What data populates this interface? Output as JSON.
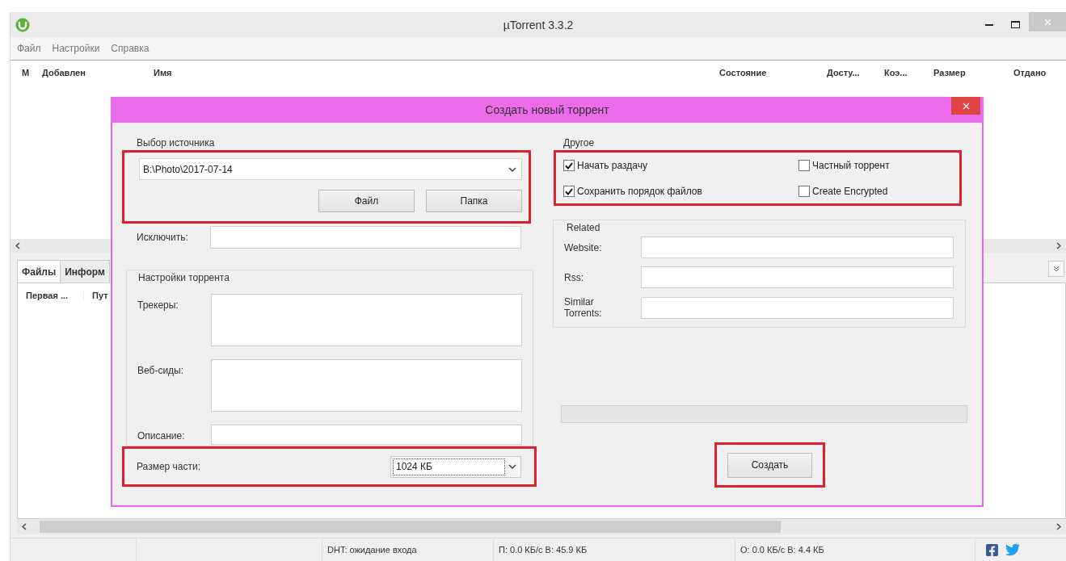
{
  "window": {
    "title": "µTorrent 3.3.2"
  },
  "menu": [
    "Файл",
    "Настройки",
    "Справка"
  ],
  "torrent_list": {
    "columns": [
      "М",
      "Добавлен",
      "Имя",
      "Состояние",
      "Досту...",
      "Коэ...",
      "Размер",
      "Отдано"
    ]
  },
  "tabs": [
    {
      "label": "Файлы",
      "selected": true
    },
    {
      "label": "Информ",
      "selected": false
    }
  ],
  "files_list": {
    "columns": [
      "Первая ...",
      "Пут"
    ]
  },
  "status_bar": [
    "DHT: ожидание входа",
    "П: 0.0 КБ/с В: 45.9 КБ",
    "О: 0.0 КБ/с В: 4.4 КБ"
  ],
  "dialog": {
    "title": "Создать новый торрент",
    "source": {
      "legend": "Выбор источника",
      "path": "B:\\Photo\\2017-07-14",
      "buttons": [
        "Файл",
        "Папка"
      ],
      "highlighted": true
    },
    "exclude": {
      "label": "Исключить:"
    },
    "torrent_settings": {
      "legend": "Настройки торрента",
      "fields": [
        {
          "label": "Трекеры:",
          "kind": "multiline"
        },
        {
          "label": "Веб-сиды:",
          "kind": "multiline"
        },
        {
          "label": "Описание:",
          "kind": "line"
        }
      ]
    },
    "piece_size": {
      "label": "Размер части:",
      "value": "1024 КБ",
      "highlighted": true
    },
    "other": {
      "legend": "Другое",
      "highlighted": true,
      "options": [
        {
          "label": "Начать раздачу",
          "checked": true
        },
        {
          "label": "Частный торрент",
          "checked": false
        },
        {
          "label": "Сохранить порядок файлов",
          "checked": true
        },
        {
          "label": "Create Encrypted",
          "checked": false
        }
      ]
    },
    "related": {
      "legend": "Related",
      "fields": [
        "Website:",
        "Rss:",
        "Similar Torrents:"
      ]
    },
    "progress": {
      "level": 0
    },
    "create_button": {
      "label": "Создать",
      "highlighted": true
    }
  }
}
